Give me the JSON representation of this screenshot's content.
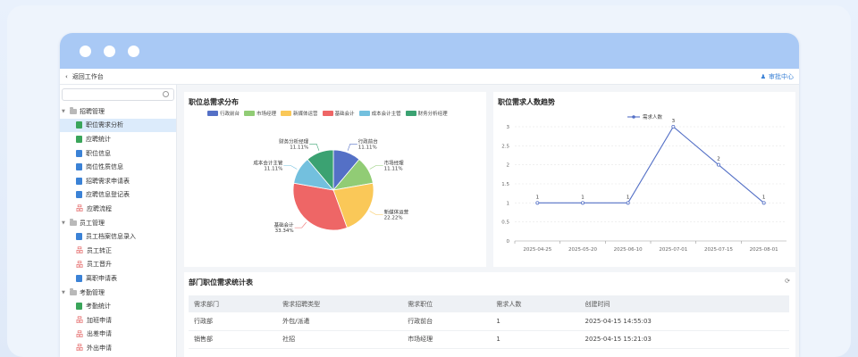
{
  "topbar": {
    "back_label": "返回工作台",
    "approval_label": "审批中心"
  },
  "sidebar": {
    "groups": [
      {
        "label": "招聘管理",
        "items": [
          {
            "label": "职位需求分析",
            "icon": "chart-icon",
            "selected": true
          },
          {
            "label": "应聘统计",
            "icon": "chart-icon"
          },
          {
            "label": "职位信息",
            "icon": "doc-icon"
          },
          {
            "label": "岗位性质信息",
            "icon": "doc-icon"
          },
          {
            "label": "招聘需求申请表",
            "icon": "doc-icon"
          },
          {
            "label": "应聘信息登记表",
            "icon": "doc-icon"
          },
          {
            "label": "应聘流程",
            "icon": "flow-icon"
          }
        ]
      },
      {
        "label": "员工管理",
        "items": [
          {
            "label": "员工档案信息录入",
            "icon": "doc-icon"
          },
          {
            "label": "员工转正",
            "icon": "flow-icon"
          },
          {
            "label": "员工晋升",
            "icon": "flow-icon"
          },
          {
            "label": "离职申请表",
            "icon": "doc-icon"
          }
        ]
      },
      {
        "label": "考勤管理",
        "items": [
          {
            "label": "考勤统计",
            "icon": "chart-icon"
          },
          {
            "label": "加班申请",
            "icon": "flow-icon"
          },
          {
            "label": "出差申请",
            "icon": "flow-icon"
          },
          {
            "label": "外出申请",
            "icon": "flow-icon"
          }
        ]
      }
    ]
  },
  "pie_card": {
    "title": "职位总需求分布"
  },
  "line_card": {
    "title": "职位需求人数趋势"
  },
  "table_card": {
    "title": "部门职位需求统计表",
    "columns": [
      "需求部门",
      "需求招聘类型",
      "需求职位",
      "需求人数",
      "创建时间"
    ],
    "rows": [
      [
        "行政部",
        "外包/派遣",
        "行政前台",
        "1",
        "2025-04-15 14:55:03"
      ],
      [
        "销售部",
        "社招",
        "市场经理",
        "1",
        "2025-04-15 15:21:03"
      ]
    ]
  },
  "chart_data": [
    {
      "type": "pie",
      "title": "职位总需求分布",
      "labels": [
        "行政前台",
        "市场经理",
        "新媒体运营",
        "基础会计",
        "成本会计主管",
        "财务分析经理"
      ],
      "values": [
        11.11,
        11.11,
        22.22,
        33.34,
        11.11,
        11.11
      ],
      "value_labels": [
        "11.11%",
        "11.11%",
        "22.22%",
        "33.34%",
        "11.11%",
        "11.11%"
      ],
      "colors": [
        "#5470c6",
        "#91cc75",
        "#fac858",
        "#ee6666",
        "#73c0de",
        "#3ba272"
      ],
      "legend": "top"
    },
    {
      "type": "line",
      "title": "职位需求人数趋势",
      "series": [
        {
          "name": "需求人数",
          "values": [
            1,
            1,
            1,
            3,
            2,
            1
          ],
          "color": "#5470c6"
        }
      ],
      "x": [
        "2025-04-25",
        "2025-05-20",
        "2025-06-10",
        "2025-07-01",
        "2025-07-15",
        "2025-08-01"
      ],
      "ylim": [
        0,
        3
      ],
      "yticks": [
        "0",
        "0.5",
        "1",
        "1.5",
        "2",
        "2.5",
        "3"
      ],
      "grid": true,
      "legend": "top-center"
    }
  ]
}
